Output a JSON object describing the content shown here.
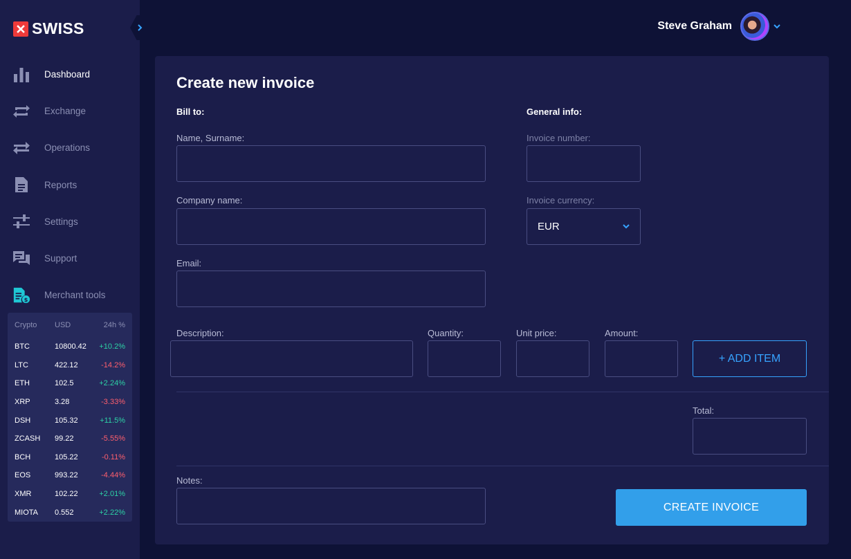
{
  "brand": {
    "name": "SWISS"
  },
  "user": {
    "name": "Steve Graham"
  },
  "nav": [
    {
      "label": "Dashboard",
      "icon": "bar-chart-icon",
      "active": true
    },
    {
      "label": "Exchange",
      "icon": "exchange-icon",
      "active": false
    },
    {
      "label": "Operations",
      "icon": "transfer-arrows-icon",
      "active": false
    },
    {
      "label": "Reports",
      "icon": "document-icon",
      "active": false
    },
    {
      "label": "Settings",
      "icon": "sliders-icon",
      "active": false
    },
    {
      "label": "Support",
      "icon": "chat-icon",
      "active": false
    },
    {
      "label": "Merchant tools",
      "icon": "invoice-dollar-icon",
      "active": false
    }
  ],
  "ticker": {
    "headers": [
      "Crypto",
      "USD",
      "24h %"
    ],
    "rows": [
      {
        "symbol": "BTC",
        "usd": "10800.42",
        "change": "+10.2%",
        "up": true
      },
      {
        "symbol": "LTC",
        "usd": "422.12",
        "change": "-14.2%",
        "up": false
      },
      {
        "symbol": "ETH",
        "usd": "102.5",
        "change": "+2.24%",
        "up": true
      },
      {
        "symbol": "XRP",
        "usd": "3.28",
        "change": "-3.33%",
        "up": false
      },
      {
        "symbol": "DSH",
        "usd": "105.32",
        "change": "+11.5%",
        "up": true
      },
      {
        "symbol": "ZCASH",
        "usd": "99.22",
        "change": "-5.55%",
        "up": false
      },
      {
        "symbol": "BCH",
        "usd": "105.22",
        "change": "-0.11%",
        "up": false
      },
      {
        "symbol": "EOS",
        "usd": "993.22",
        "change": "-4.44%",
        "up": false
      },
      {
        "symbol": "XMR",
        "usd": "102.22",
        "change": "+2.01%",
        "up": true
      },
      {
        "symbol": "MIOTA",
        "usd": "0.552",
        "change": "+2.22%",
        "up": true
      }
    ]
  },
  "form": {
    "title": "Create new invoice",
    "bill_to": "Bill to:",
    "general_info": "General info:",
    "name_label": "Name, Surname:",
    "name_value": "",
    "company_label": "Company name:",
    "company_value": "",
    "email_label": "Email:",
    "email_value": "",
    "invoice_number_label": "Invoice number:",
    "invoice_number_value": "",
    "currency_label": "Invoice currency:",
    "currency_value": "EUR",
    "description_label": "Description:",
    "quantity_label": "Quantity:",
    "unit_price_label": "Unit price:",
    "amount_label": "Amount:",
    "add_item": "+ ADD ITEM",
    "total_label": "Total:",
    "notes_label": "Notes:",
    "create_invoice": "CREATE INVOICE"
  },
  "colors": {
    "accent": "#329fea",
    "positive": "#2dd3a6",
    "negative": "#ff5f6d",
    "brand_red": "#ee3a3a"
  }
}
